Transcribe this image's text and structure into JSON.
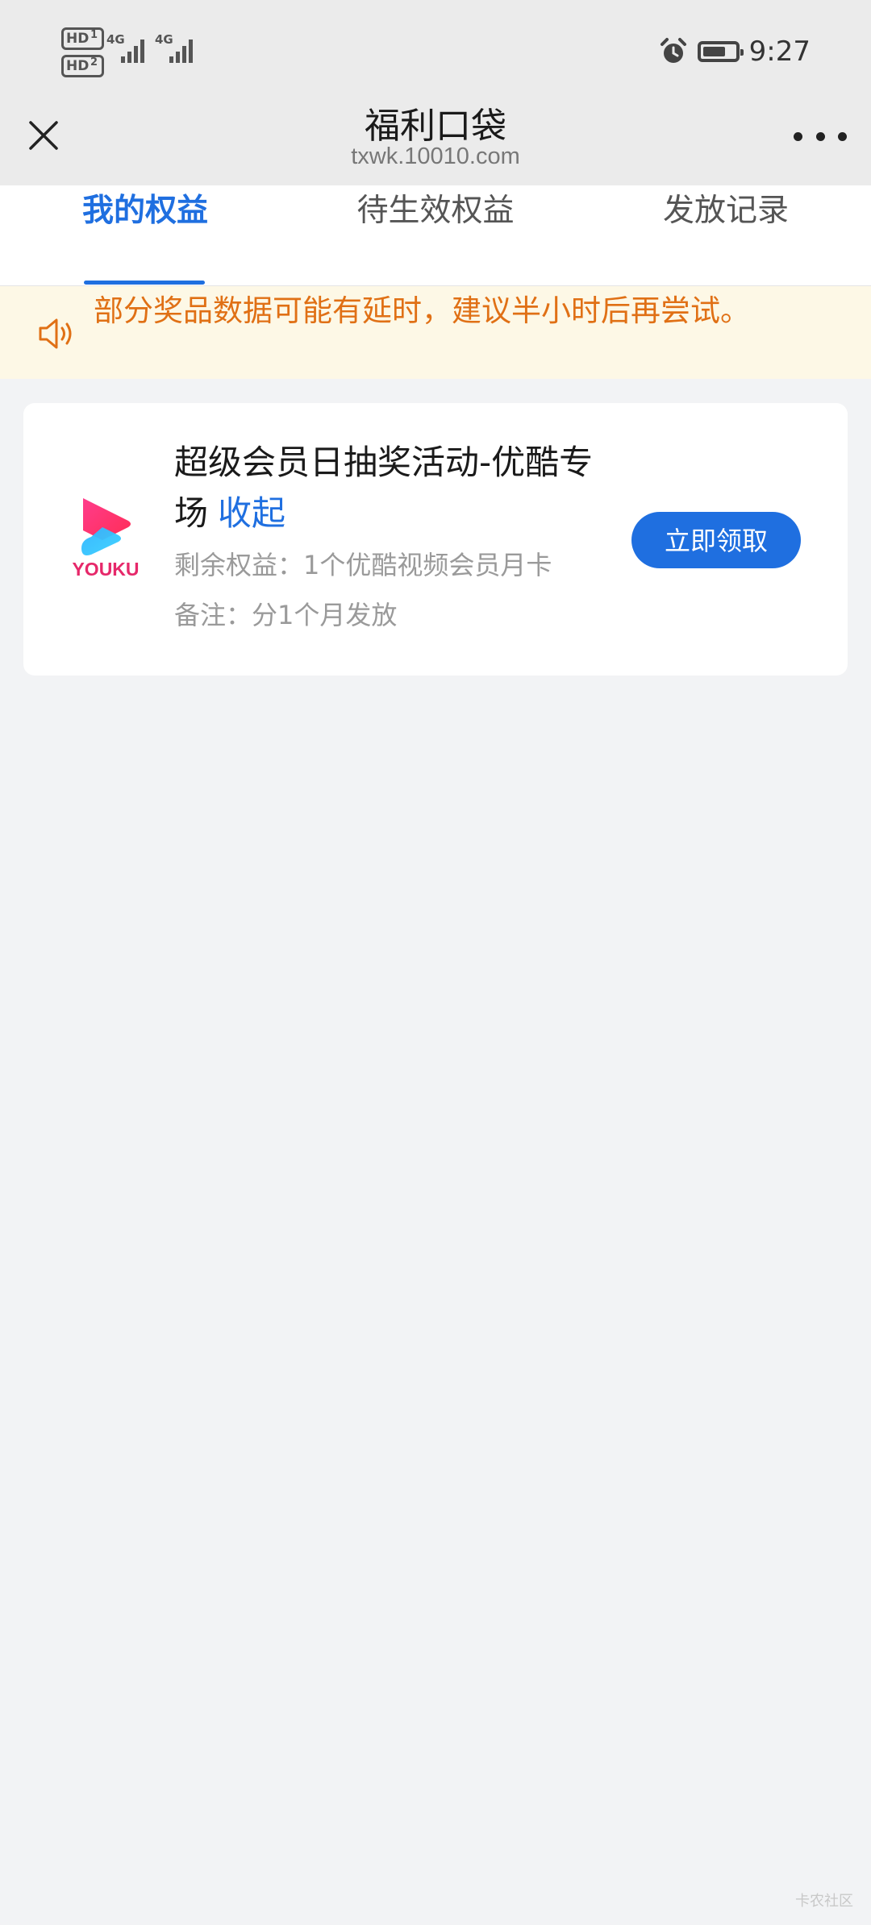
{
  "status_bar": {
    "sim1_badge": "HD",
    "sim1_index": "1",
    "sim2_badge": "HD",
    "sim2_index": "2",
    "network1": "4G",
    "network2": "4G",
    "time": "9:27",
    "battery_level": 0.7,
    "icons": [
      "alarm-icon",
      "battery-icon",
      "signal-icon"
    ]
  },
  "nav": {
    "title": "福利口袋",
    "subtitle": "txwk.10010.com",
    "close_icon": "close-icon",
    "more_icon": "more-icon"
  },
  "tabs": [
    {
      "label": "我的权益",
      "active": true
    },
    {
      "label": "待生效权益",
      "active": false
    },
    {
      "label": "发放记录",
      "active": false
    }
  ],
  "notice": {
    "icon": "speaker-icon",
    "text": "部分奖品数据可能有延时，建议半小时后再尝试。"
  },
  "card": {
    "logo": "youku-logo",
    "logo_text": "YOUKU",
    "title": "超级会员日抽奖活动-优酷专场",
    "collapse_label": "收起",
    "remaining": "剩余权益：1个优酷视频会员月卡",
    "note": "备注：分1个月发放",
    "claim_label": "立即领取"
  },
  "watermark": "卡农社区",
  "colors": {
    "accent": "#1f6fe0",
    "notice_text": "#e07015",
    "notice_bg": "#fdf8e6",
    "page_bg": "#f2f3f5"
  }
}
